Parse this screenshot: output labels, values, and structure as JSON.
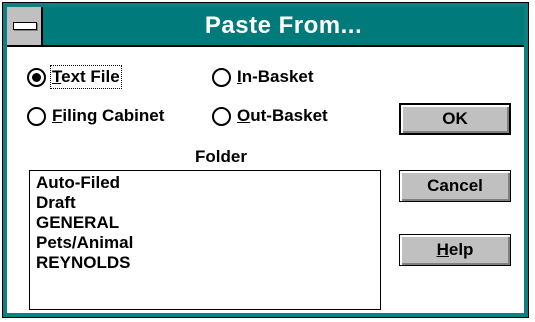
{
  "dialog": {
    "title": "Paste From..."
  },
  "source": {
    "options": [
      {
        "label_pre": "",
        "label_ul": "T",
        "label_post": "ext File",
        "selected": true
      },
      {
        "label_pre": "",
        "label_ul": "I",
        "label_post": "n-Basket",
        "selected": false
      },
      {
        "label_pre": "",
        "label_ul": "F",
        "label_post": "iling Cabinet",
        "selected": false
      },
      {
        "label_pre": "",
        "label_ul": "O",
        "label_post": "ut-Basket",
        "selected": false
      }
    ]
  },
  "folder": {
    "label": "Folder",
    "items": [
      "Auto-Filed",
      "Draft",
      "GENERAL",
      "Pets/Animal",
      "REYNOLDS"
    ]
  },
  "buttons": {
    "ok": "OK",
    "cancel": "Cancel",
    "help_ul": "H",
    "help_post": "elp"
  },
  "colors": {
    "titlebar": "#007a7a",
    "frame": "#0e8080",
    "button_face": "#c0c0c0"
  }
}
